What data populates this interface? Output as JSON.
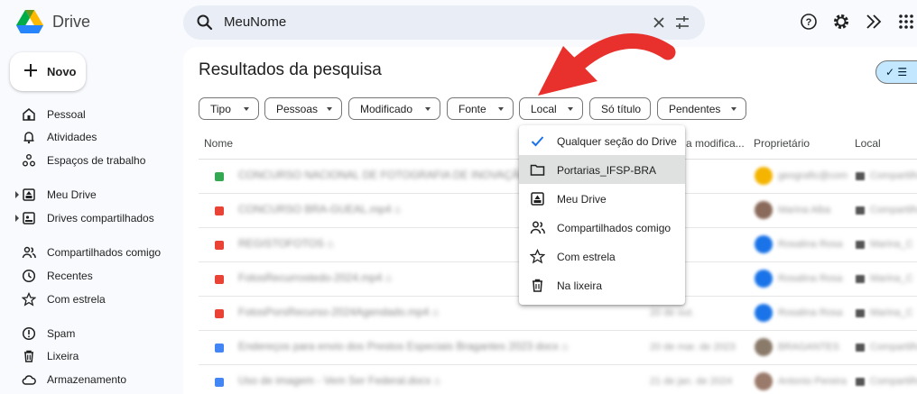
{
  "app": {
    "name": "Drive"
  },
  "search": {
    "value": "MeuNome"
  },
  "new_button": {
    "label": "Novo"
  },
  "sidebar": {
    "items": [
      {
        "label": "Pessoal",
        "icon": "home-icon"
      },
      {
        "label": "Atividades",
        "icon": "bell-icon"
      },
      {
        "label": "Espaços de trabalho",
        "icon": "workspaces-icon"
      },
      {
        "label": "Meu Drive",
        "icon": "my-drive-icon"
      },
      {
        "label": "Drives compartilhados",
        "icon": "shared-drives-icon"
      },
      {
        "label": "Compartilhados comigo",
        "icon": "people-icon"
      },
      {
        "label": "Recentes",
        "icon": "clock-icon"
      },
      {
        "label": "Com estrela",
        "icon": "star-icon"
      },
      {
        "label": "Spam",
        "icon": "spam-icon"
      },
      {
        "label": "Lixeira",
        "icon": "trash-icon"
      },
      {
        "label": "Armazenamento",
        "icon": "cloud-icon"
      }
    ]
  },
  "main": {
    "title": "Resultados da pesquisa",
    "view_toggle": "✓ ☰",
    "filters": [
      "Tipo",
      "Pessoas",
      "Modificado",
      "Fonte",
      "Local",
      "Só título",
      "Pendentes"
    ],
    "columns": {
      "name": "Nome",
      "modified": "a modifica...",
      "owner": "Proprietário",
      "location": "Local"
    },
    "rows": [
      {
        "name": "CONCURSO NACIONAL DE FOTOGRAFIA DE INOVAÇÃO ⌂",
        "date": "",
        "owner": "geografic@com",
        "location": "Compartilhados",
        "color": "#34a853",
        "avatar": "#f4b400"
      },
      {
        "name": "CONCURSO BRA-GUEAL.mp4 ⌂",
        "date": "",
        "owner": "Marina Alba",
        "location": "Compartilhados",
        "color": "#ea4335",
        "avatar": "#8a6a5a"
      },
      {
        "name": "REGISTOFOTOS ⌂",
        "date": "",
        "owner": "Rosalina Rosa",
        "location": "Marina_C",
        "color": "#ea4335",
        "avatar": "#1a73e8"
      },
      {
        "name": "FotosRecurrostedo-2024.mp4 ⌂",
        "date": "",
        "owner": "Rosalina Rosa",
        "location": "Marina_C",
        "color": "#ea4335",
        "avatar": "#1a73e8"
      },
      {
        "name": "FotosPorsRecurso-2024Agendado.mp4 ⌂",
        "date": "20 de out.",
        "owner": "Rosalina Rosa",
        "location": "Marina_C",
        "color": "#ea4335",
        "avatar": "#1a73e8"
      },
      {
        "name": "Endereços para envio dos Prestos Especiais Bragantes 2023 docx ⌂",
        "date": "20 de mar. de 2023",
        "owner": "BRAGANTES",
        "location": "Compartilhados",
        "color": "#4285f4",
        "avatar": "#8a7a6a"
      },
      {
        "name": "Uso de imagem - Vem Ser Federal.docx ⌂",
        "date": "21 de jan. de 2024",
        "owner": "Antonio Pereira",
        "location": "Compartilhados",
        "color": "#4285f4",
        "avatar": "#9a7a6a"
      }
    ]
  },
  "location_menu": {
    "items": [
      {
        "label": "Qualquer seção do Drive",
        "icon": "check-icon"
      },
      {
        "label": "Portarias_IFSP-BRA",
        "icon": "folder-icon"
      },
      {
        "label": "Meu Drive",
        "icon": "my-drive-icon"
      },
      {
        "label": "Compartilhados comigo",
        "icon": "people-icon"
      },
      {
        "label": "Com estrela",
        "icon": "star-icon"
      },
      {
        "label": "Na lixeira",
        "icon": "trash-icon"
      }
    ]
  },
  "colors": {
    "accent": "#1a73e8",
    "arrow": "#e8312c",
    "search_bg": "#e9eef6",
    "page_bg": "#f8fafd"
  }
}
